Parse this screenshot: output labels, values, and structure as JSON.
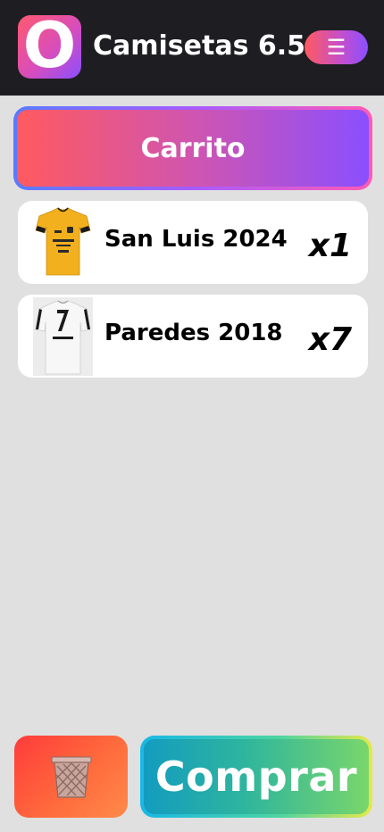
{
  "header": {
    "logo_letter": "O",
    "title": "Camisetas 6.5",
    "menu_icon": "hamburger-menu-icon",
    "colors": {
      "bar_background": "#1e1e22",
      "logo_gradient": [
        "#ff5a6e",
        "#d84dbb",
        "#8a4fff"
      ],
      "menu_gradient": [
        "#ff5a5f",
        "#c24fd0",
        "#8a4fff"
      ]
    }
  },
  "cart": {
    "title": "Carrito",
    "colors": {
      "header_gradient": [
        "#ff5a5f",
        "#d055b0",
        "#8a4fff"
      ],
      "header_border": [
        "#5a7bff",
        "#a65cff",
        "#ff5ab4"
      ]
    },
    "items": [
      {
        "name": "San Luis 2024",
        "quantity": "x1",
        "image": "yellow-jersey-image",
        "color": "#f2b01e"
      },
      {
        "name": "Paredes 2018",
        "quantity": "x7",
        "image": "white-jersey-image",
        "color": "#f4f4f4"
      }
    ]
  },
  "actions": {
    "trash_icon": "trash-basket-icon",
    "buy_label": "Comprar",
    "colors": {
      "trash_gradient": [
        "#ff3b3b",
        "#ff6a3d",
        "#ff8a4a"
      ],
      "buy_gradient": [
        "#139cbf",
        "#2fb59e",
        "#79d66b"
      ],
      "buy_border": [
        "#19b8e6",
        "#4cd4a0",
        "#e6e84a"
      ]
    }
  }
}
